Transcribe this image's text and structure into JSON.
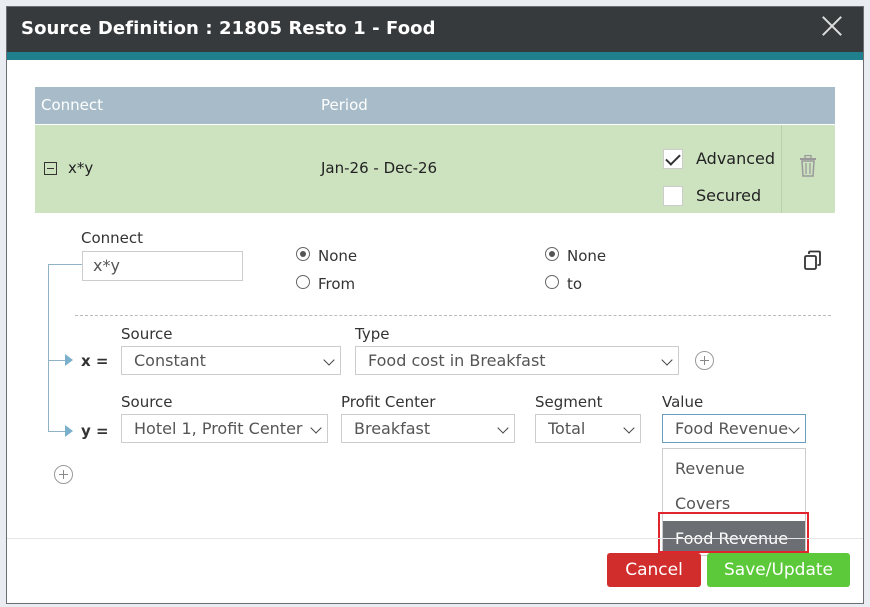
{
  "dialog": {
    "title": "Source Definition : 21805 Resto 1 - Food"
  },
  "table": {
    "headers": {
      "connect": "Connect",
      "period": "Period"
    },
    "row": {
      "connect": "x*y",
      "period": "Jan-26 - Dec-26",
      "advanced_label": "Advanced",
      "advanced_checked": true,
      "secured_label": "Secured",
      "secured_checked": false
    }
  },
  "detail": {
    "connect_label": "Connect",
    "connect_value": "x*y",
    "from_group": {
      "none": "None",
      "from": "From",
      "selected": "None"
    },
    "to_group": {
      "none": "None",
      "to": "to",
      "selected": "None"
    },
    "x": {
      "eq": "x =",
      "source_label": "Source",
      "source_value": "Constant",
      "type_label": "Type",
      "type_value": "Food cost in Breakfast"
    },
    "y": {
      "eq": "y =",
      "source_label": "Source",
      "source_value": "Hotel 1, Profit Center",
      "profit_center_label": "Profit Center",
      "profit_center_value": "Breakfast",
      "segment_label": "Segment",
      "segment_value": "Total",
      "value_label": "Value",
      "value_value": "Food Revenue"
    },
    "value_options": [
      "Revenue",
      "Covers",
      "Food Revenue"
    ],
    "value_selected": "Food Revenue"
  },
  "footer": {
    "cancel": "Cancel",
    "save": "Save/Update"
  },
  "colors": {
    "titlebar": "#373a3d",
    "accent": "#1f7f8c",
    "header": "#a7bcc8",
    "row": "#cde3c0",
    "cancel": "#d22d2d",
    "save": "#5cc93a",
    "highlight": "#e0262c"
  }
}
